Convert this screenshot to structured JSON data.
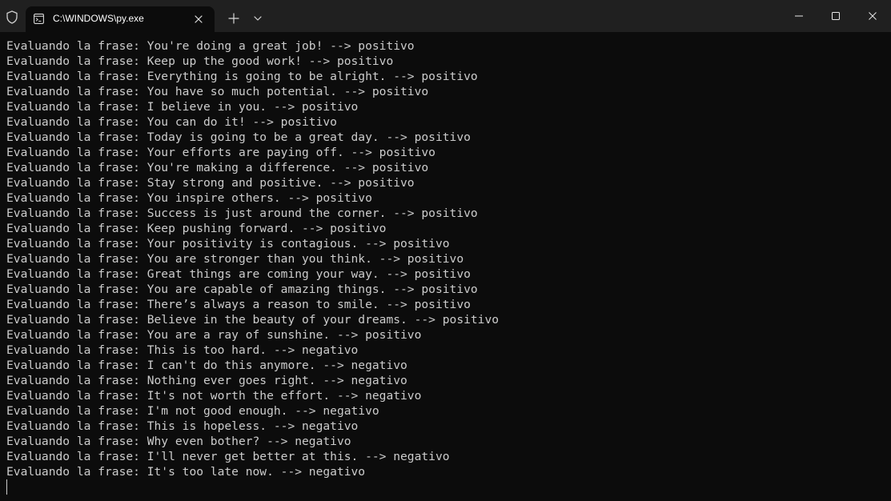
{
  "window": {
    "tab_title": "C:\\WINDOWS\\py.exe",
    "icons": {
      "shield": "shield-icon",
      "tab": "terminal-icon",
      "tab_close": "close-icon",
      "new_tab": "plus-icon",
      "dropdown": "chevron-down-icon",
      "minimize": "minimize-icon",
      "maximize": "maximize-icon",
      "close": "close-icon"
    }
  },
  "colors": {
    "titlebar": "#202020",
    "console_bg": "#0c0c0c",
    "console_text": "#cccccc"
  },
  "console": {
    "lines": [
      "Evaluando la frase: You're doing a great job! --> positivo",
      "Evaluando la frase: Keep up the good work! --> positivo",
      "Evaluando la frase: Everything is going to be alright. --> positivo",
      "Evaluando la frase: You have so much potential. --> positivo",
      "Evaluando la frase: I believe in you. --> positivo",
      "Evaluando la frase: You can do it! --> positivo",
      "Evaluando la frase: Today is going to be a great day. --> positivo",
      "Evaluando la frase: Your efforts are paying off. --> positivo",
      "Evaluando la frase: You're making a difference. --> positivo",
      "Evaluando la frase: Stay strong and positive. --> positivo",
      "Evaluando la frase: You inspire others. --> positivo",
      "Evaluando la frase: Success is just around the corner. --> positivo",
      "Evaluando la frase: Keep pushing forward. --> positivo",
      "Evaluando la frase: Your positivity is contagious. --> positivo",
      "Evaluando la frase: You are stronger than you think. --> positivo",
      "Evaluando la frase: Great things are coming your way. --> positivo",
      "Evaluando la frase: You are capable of amazing things. --> positivo",
      "Evaluando la frase: There’s always a reason to smile. --> positivo",
      "Evaluando la frase: Believe in the beauty of your dreams. --> positivo",
      "Evaluando la frase: You are a ray of sunshine. --> positivo",
      "Evaluando la frase: This is too hard. --> negativo",
      "Evaluando la frase: I can't do this anymore. --> negativo",
      "Evaluando la frase: Nothing ever goes right. --> negativo",
      "Evaluando la frase: It's not worth the effort. --> negativo",
      "Evaluando la frase: I'm not good enough. --> negativo",
      "Evaluando la frase: This is hopeless. --> negativo",
      "Evaluando la frase: Why even bother? --> negativo",
      "Evaluando la frase: I'll never get better at this. --> negativo",
      "Evaluando la frase: It's too late now. --> negativo"
    ]
  }
}
